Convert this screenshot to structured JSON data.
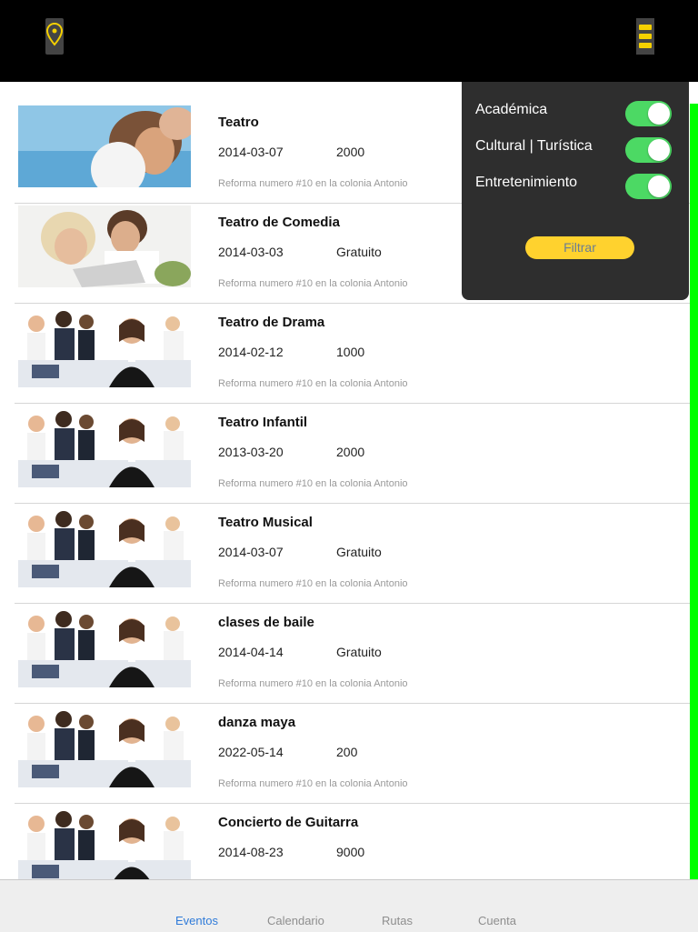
{
  "filter": {
    "items": [
      {
        "label": "Académica",
        "on": true
      },
      {
        "label": "Cultural | Turística",
        "on": true
      },
      {
        "label": "Entretenimiento",
        "on": true
      }
    ],
    "button_label": "Filtrar"
  },
  "events": [
    {
      "title": "Teatro",
      "date": "2014-03-07",
      "price": "2000",
      "address": "Reforma numero #10 en la colonia Antonio",
      "image": "couple-beach"
    },
    {
      "title": "Teatro de Comedia",
      "date": "2014-03-03",
      "price": "Gratuito",
      "address": "Reforma numero #10 en la colonia Antonio",
      "image": "couple-laptop"
    },
    {
      "title": "Teatro de Drama",
      "date": "2014-02-12",
      "price": "1000",
      "address": "Reforma numero #10 en la colonia Antonio",
      "image": "office-team"
    },
    {
      "title": "Teatro Infantil",
      "date": "2013-03-20",
      "price": "2000",
      "address": "Reforma numero #10 en la colonia Antonio",
      "image": "office-team"
    },
    {
      "title": "Teatro Musical",
      "date": "2014-03-07",
      "price": "Gratuito",
      "address": "Reforma numero #10 en la colonia Antonio",
      "image": "office-team"
    },
    {
      "title": "clases de baile",
      "date": "2014-04-14",
      "price": "Gratuito",
      "address": "Reforma numero #10 en la colonia Antonio",
      "image": "office-team"
    },
    {
      "title": "danza maya",
      "date": "2022-05-14",
      "price": "200",
      "address": "Reforma numero #10 en la colonia Antonio",
      "image": "office-team"
    },
    {
      "title": "Concierto de Guitarra",
      "date": "2014-08-23",
      "price": "9000",
      "address": "",
      "image": "office-team"
    }
  ],
  "tabs": [
    {
      "label": "Eventos",
      "active": true
    },
    {
      "label": "Calendario",
      "active": false
    },
    {
      "label": "Rutas",
      "active": false
    },
    {
      "label": "Cuenta",
      "active": false
    }
  ],
  "colors": {
    "accent_yellow": "#f5d000",
    "toggle_green": "#4cd964",
    "side_bar_green": "#00ff00",
    "tab_active": "#2f7bd9"
  }
}
